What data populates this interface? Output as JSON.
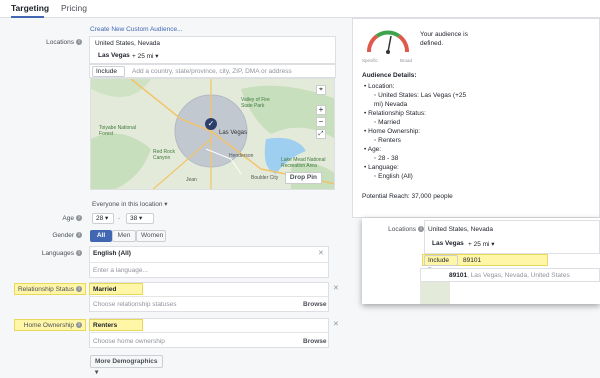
{
  "tabs": [
    {
      "label": "Targeting"
    },
    {
      "label": "Pricing"
    }
  ],
  "create_link": "Create New Custom Audience...",
  "locations": {
    "label": "Locations",
    "country": "United States, Nevada",
    "city": "Las Vegas",
    "radius": "+  25 mi",
    "include_label": "Include",
    "input_placeholder": "Add a country, state/province, city, ZIP, DMA or address",
    "drop_pin": "Drop Pin",
    "scope": "Everyone in this location",
    "map_labels": [
      "Valley of Fire State Park",
      "Toiyabe National Forest",
      "Las Vegas",
      "Lake Mead National Recreation Area",
      "Red Rock Canyon",
      "Jean",
      "Boulder City",
      "Henderson"
    ]
  },
  "age": {
    "label": "Age",
    "min": "28",
    "dash": "-",
    "max": "38"
  },
  "gender": {
    "label": "Gender",
    "options": [
      "All",
      "Men",
      "Women"
    ],
    "selected": "All"
  },
  "languages": {
    "label": "Languages",
    "value": "English (All)",
    "placeholder": "Enter a language..."
  },
  "relationship": {
    "label": "Relationship Status",
    "value": "Married",
    "placeholder": "Choose relationship statuses",
    "browse": "Browse"
  },
  "home": {
    "label": "Home Ownership",
    "value": "Renters",
    "placeholder": "Choose home ownership",
    "browse": "Browse"
  },
  "more_demo": "More Demographics",
  "gauge": {
    "specific": "Specific",
    "broad": "Broad",
    "text": "Your audience is defined."
  },
  "audience": {
    "title": "Audience Details:",
    "items": [
      {
        "head": "Location:",
        "sub": "United States: Las Vegas (+25 mi) Nevada"
      },
      {
        "head": "Relationship Status:",
        "sub": "Married"
      },
      {
        "head": "Home Ownership:",
        "sub": "Renters"
      },
      {
        "head": "Age:",
        "sub": "28 - 38"
      },
      {
        "head": "Language:",
        "sub": "English (All)"
      }
    ],
    "reach": "Potential Reach: 37,000 people"
  },
  "inset": {
    "label": "Locations",
    "country": "United States, Nevada",
    "city": "Las Vegas",
    "radius": "+  25 mi",
    "include_label": "Include",
    "input_value": "89101",
    "suggestion_bold": "89101",
    "suggestion_rest": ", Las Vegas, Nevada, United States"
  },
  "colors": {
    "accent": "#4267b2",
    "highlight": "#fff6a8"
  }
}
